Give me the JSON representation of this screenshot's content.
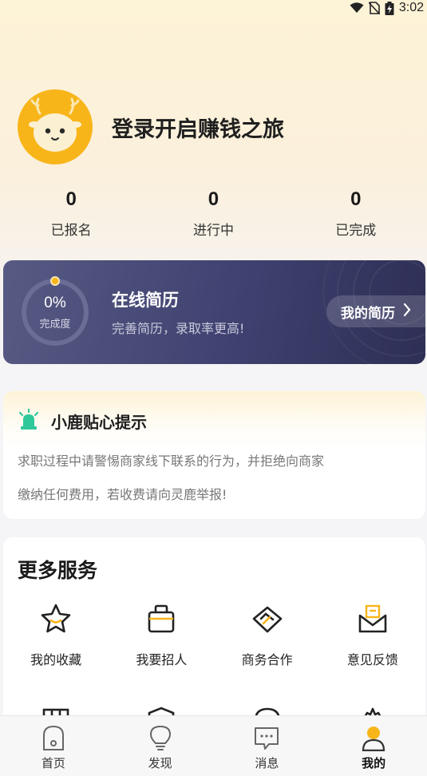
{
  "status_bar": {
    "time": "3:02"
  },
  "profile": {
    "login_prompt": "登录开启赚钱之旅",
    "avatar_icon": "deer-mascot-icon"
  },
  "stats": [
    {
      "value": "0",
      "label": "已报名"
    },
    {
      "value": "0",
      "label": "进行中"
    },
    {
      "value": "0",
      "label": "已完成"
    }
  ],
  "resume": {
    "progress_text": "0%",
    "progress_label": "完成度",
    "progress_fraction": 0.0,
    "title": "在线简历",
    "subtitle": "完善简历，录取率更高!",
    "button_label": "我的简历"
  },
  "tips": {
    "title": "小鹿贴心提示",
    "line1": "求职过程中请警惕商家线下联系的行为，并拒绝向商家",
    "line2": "缴纳任何费用，若收费请向灵鹿举报!",
    "icon": "alarm-light-icon"
  },
  "services": {
    "title": "更多服务",
    "items": [
      {
        "label": "我的收藏",
        "icon": "star-icon"
      },
      {
        "label": "我要招人",
        "icon": "briefcase-icon"
      },
      {
        "label": "商务合作",
        "icon": "handshake-icon"
      },
      {
        "label": "意见反馈",
        "icon": "mail-feedback-icon"
      }
    ]
  },
  "tabbar": {
    "items": [
      {
        "label": "首页",
        "icon": "home-icon"
      },
      {
        "label": "发现",
        "icon": "bulb-icon"
      },
      {
        "label": "消息",
        "icon": "message-icon"
      },
      {
        "label": "我的",
        "icon": "profile-icon"
      }
    ],
    "active_index": 3
  },
  "colors": {
    "accent": "#f8b51a",
    "resume_bg": "#3f4170",
    "tips_icon": "#2fc89a"
  }
}
